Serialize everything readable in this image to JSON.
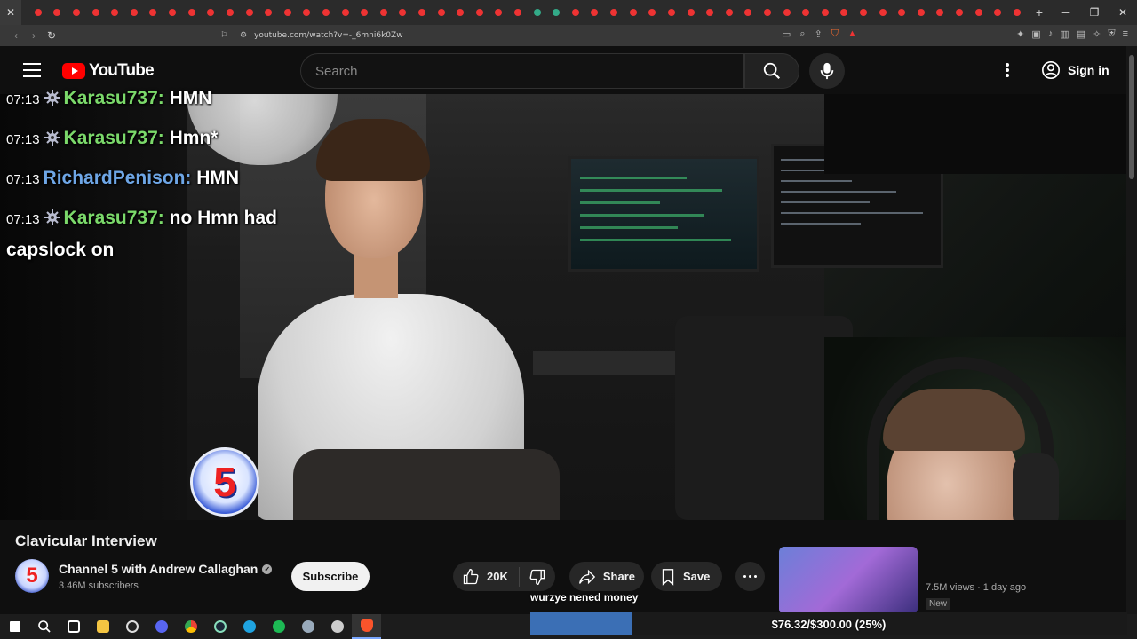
{
  "browser": {
    "url": "youtube.com/watch?v=-_6mni6k0Zw",
    "tab_dot_colors": [
      "#e33",
      "#e33",
      "#e33",
      "#e33",
      "#e33",
      "#e33",
      "#e33",
      "#e33",
      "#e33",
      "#e33",
      "#e33",
      "#e33",
      "#e33",
      "#e33",
      "#e33",
      "#e33",
      "#e33",
      "#e33",
      "#e33",
      "#e33",
      "#e33",
      "#e33",
      "#e33",
      "#e33",
      "#e33",
      "#e33",
      "#3a8",
      "#3a8",
      "#e33",
      "#e33",
      "#e33",
      "#e33",
      "#e33",
      "#e33",
      "#e33",
      "#e33",
      "#e33",
      "#e33",
      "#e33",
      "#e33",
      "#e33",
      "#e33",
      "#e33",
      "#e33",
      "#e33",
      "#e33",
      "#e33",
      "#e33",
      "#e33",
      "#e33",
      "#e33",
      "#e33"
    ],
    "new_tab_label": "+"
  },
  "youtube": {
    "logo_text": "YouTube",
    "search_placeholder": "Search",
    "sign_in_label": "Sign in"
  },
  "chat": [
    {
      "time": "07:13",
      "user": "Karasu737:",
      "message": "HMN",
      "user_color": "green",
      "emote": true
    },
    {
      "time": "07:13",
      "user": "Karasu737:",
      "message": "Hmn*",
      "user_color": "green",
      "emote": true
    },
    {
      "time": "07:13",
      "user": "RichardPenison:",
      "message": "HMN",
      "user_color": "blue",
      "emote": false
    },
    {
      "time": "07:13",
      "user": "Karasu737:",
      "message": "no Hmn had capslock on",
      "user_color": "green",
      "emote": true
    }
  ],
  "video": {
    "channel_badge": "5",
    "title": "Clavicular Interview"
  },
  "channel": {
    "name": "Channel 5 with Andrew Callaghan",
    "verified_mark": "✓",
    "subscribers": "3.46M subscribers",
    "subscribe_label": "Subscribe"
  },
  "actions": {
    "likes": "20K",
    "share_label": "Share",
    "save_label": "Save"
  },
  "recommendation": {
    "meta": "7.5M views · 1 day ago",
    "badge": "New"
  },
  "donation": {
    "label": "wurzye nened money",
    "goal_text": "$76.32/$300.00 (25%)",
    "progress": 0.25
  },
  "colors": {
    "accent_red": "#ff0000",
    "chat_green": "#7bd96a",
    "chat_blue": "#6ea6e6",
    "goal_fill": "#3b6fb5"
  }
}
